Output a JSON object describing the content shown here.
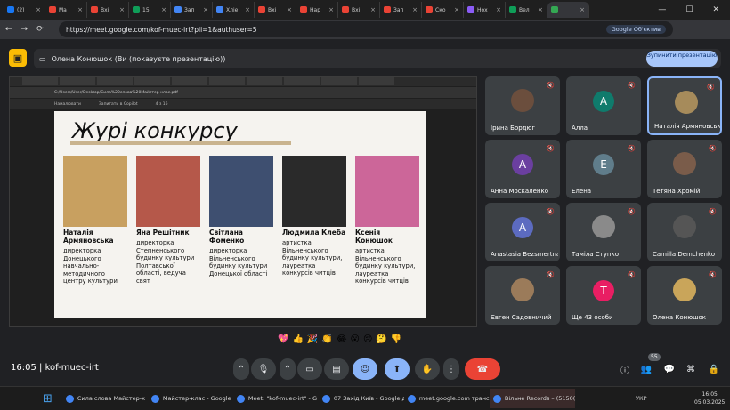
{
  "browser": {
    "tabs": [
      {
        "title": "(2)",
        "color": "#1877f2"
      },
      {
        "title": "Ма",
        "color": "#ea4335"
      },
      {
        "title": "Вхі",
        "color": "#ea4335"
      },
      {
        "title": "15.",
        "color": "#0f9d58"
      },
      {
        "title": "Зап",
        "color": "#4285f4"
      },
      {
        "title": "Хліе",
        "color": "#4285f4"
      },
      {
        "title": "Вхі",
        "color": "#ea4335"
      },
      {
        "title": "Нар",
        "color": "#ea4335"
      },
      {
        "title": "Вхі",
        "color": "#ea4335"
      },
      {
        "title": "Зап",
        "color": "#ea4335"
      },
      {
        "title": "Ско",
        "color": "#ea4335"
      },
      {
        "title": "Нох",
        "color": "#8b5cf6"
      },
      {
        "title": "Вел",
        "color": "#0f9d58"
      },
      {
        "title": "",
        "color": "#34a853"
      }
    ],
    "url": "https://meet.google.com/kof-muec-irt?pli=1&authuser=5",
    "ge_label": "Google Об'єктив"
  },
  "meet": {
    "presenter": "Олена Конюшок (Ви (показуєте презентацію))",
    "stop_btn": "Зупинити презентацію",
    "meeting_code": "kof-muec-irt",
    "time": "16:05",
    "people_count": "55",
    "participants": [
      {
        "name": "Ірина Бордюг",
        "initial": "",
        "color": "#6b4e3d"
      },
      {
        "name": "Алла",
        "initial": "A",
        "color": "#0f7b6c"
      },
      {
        "name": "Наталія Армяновська",
        "initial": "",
        "color": "#a68b5b"
      },
      {
        "name": "Анна Москаленко",
        "initial": "A",
        "color": "#6b3fa0"
      },
      {
        "name": "Елена",
        "initial": "E",
        "color": "#607d8b"
      },
      {
        "name": "Тетяна Хромій",
        "initial": "",
        "color": "#7a5c4a"
      },
      {
        "name": "Anastasia Bezsmertna",
        "initial": "A",
        "color": "#5c6bc0"
      },
      {
        "name": "Таміла Ступко",
        "initial": "",
        "color": "#8a8a8a"
      },
      {
        "name": "Camilla Demchenko",
        "initial": "",
        "color": "#555"
      },
      {
        "name": "Євген Садовничий",
        "initial": "",
        "color": "#9b7b5a"
      },
      {
        "name": "Ще 43 особи",
        "initial": "T",
        "color": "#e91e63"
      },
      {
        "name": "Олена Конюшок",
        "initial": "",
        "color": "#c9a55a"
      }
    ]
  },
  "shared": {
    "file_path": "C:/Users/User/Desktop/Сила%20слова%20Майстер-клас.pdf",
    "tool_draw": "Намалювати",
    "tool_copilot": "Запитати в Copilot",
    "page_num": "4",
    "page_total": "з 16",
    "slide_title": "Журі конкурсу",
    "judges": [
      {
        "name": "Наталія Армяновська",
        "role": "директорка Донецького навчально-методичного центру культури",
        "color": "#c8a060"
      },
      {
        "name": "Яна Решітник",
        "role": "директорка Степненського будинку культури Полтавської області, ведуча свят",
        "color": "#b5584a"
      },
      {
        "name": "Світлана Фоменко",
        "role": "директорка Вільненського будинку культури Донецької області",
        "color": "#3e4f70"
      },
      {
        "name": "Людмила Клеба",
        "role": "артистка Вільненського будинку культури, лауреатка конкурсів читців",
        "color": "#2a2a2a"
      },
      {
        "name": "Ксенія Конюшок",
        "role": "артистка Вільненського будинку культури, лауреатка конкурсів читців",
        "color": "#cc6699"
      }
    ]
  },
  "reactions": [
    "💖",
    "👍",
    "🎉",
    "👏",
    "😂",
    "😮",
    "😢",
    "🤔",
    "👎"
  ],
  "taskbar": {
    "items": [
      "Сила слова Майстер-к",
      "Майстер-клас - Google",
      "Meet: \"kof-muec-irt\" - G",
      "07 Захід Київ - Google д",
      "meet.google.com транс",
      "Вільне Records – (5150("
    ],
    "lang": "УКР",
    "time": "16:05",
    "date": "05.03.2025"
  }
}
